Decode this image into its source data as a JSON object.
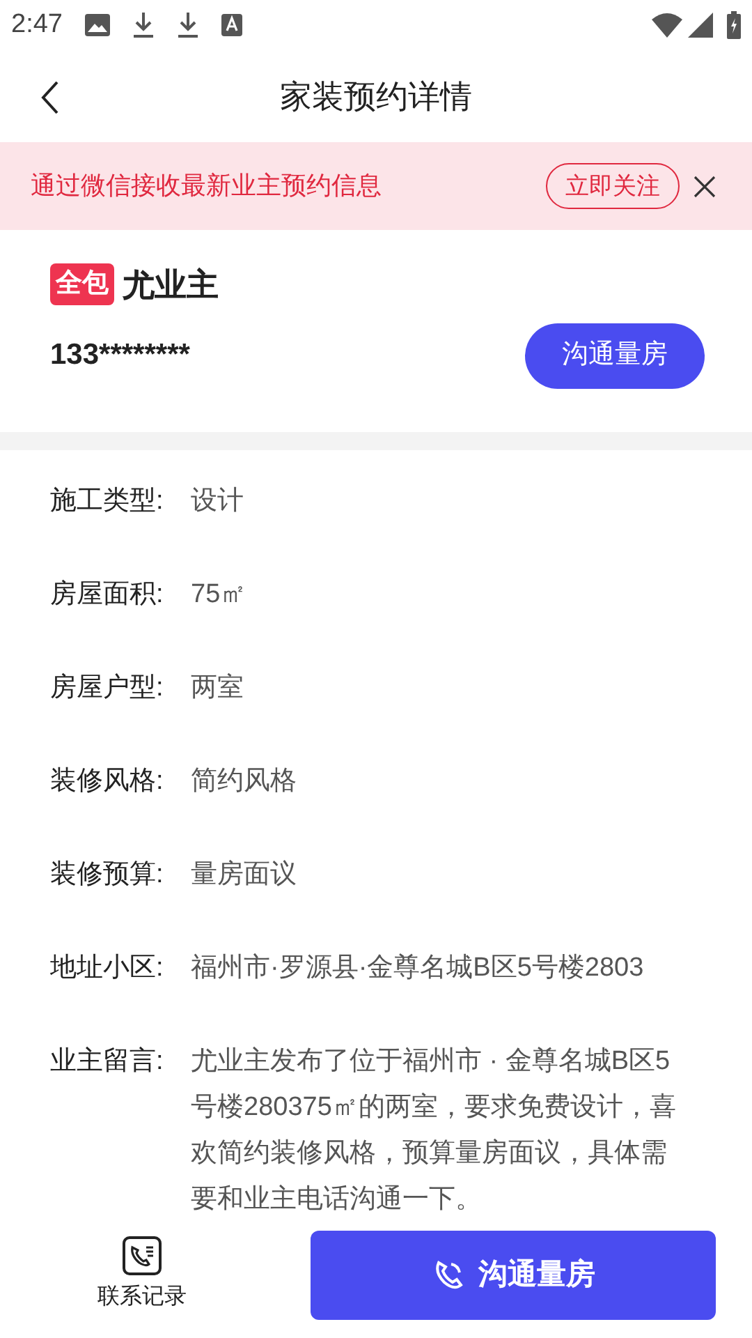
{
  "status_bar": {
    "time": "2:47"
  },
  "header": {
    "title": "家装预约详情"
  },
  "banner": {
    "text": "通过微信接收最新业主预约信息",
    "button": "立即关注"
  },
  "owner": {
    "tag": "全包",
    "name": "尤业主",
    "phone": "133********",
    "button": "沟通量房"
  },
  "details": [
    {
      "label": "施工类型:",
      "value": "设计"
    },
    {
      "label": "房屋面积:",
      "value": "75㎡"
    },
    {
      "label": "房屋户型:",
      "value": "两室"
    },
    {
      "label": "装修风格:",
      "value": "简约风格"
    },
    {
      "label": "装修预算:",
      "value": "量房面议"
    },
    {
      "label": "地址小区:",
      "value": "福州市·罗源县·金尊名城B区5号楼2803"
    },
    {
      "label": "业主留言:",
      "value": "尤业主发布了位于福州市 · 金尊名城B区5号楼280375㎡的两室，要求免费设计，喜欢简约装修风格，预算量房面议，具体需要和业主电话沟通一下。"
    }
  ],
  "bottom_bar": {
    "records": "联系记录",
    "call_button": "沟通量房"
  }
}
